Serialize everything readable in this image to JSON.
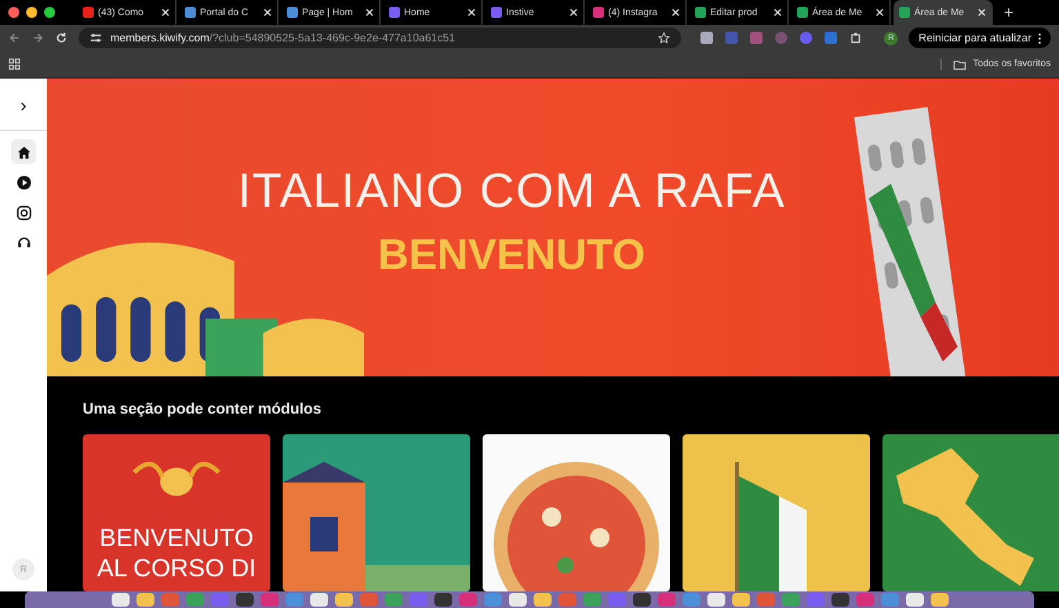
{
  "browser": {
    "tabs": [
      {
        "title": "(43) Como",
        "color": "#e62117",
        "selected": false
      },
      {
        "title": "Portal do C",
        "color": "#4a8fd8",
        "selected": false
      },
      {
        "title": "Page | Hom",
        "color": "#4a8fd8",
        "selected": false
      },
      {
        "title": "Home",
        "color": "#7a5cf0",
        "selected": false
      },
      {
        "title": "Instive",
        "color": "#7a5cf0",
        "selected": false
      },
      {
        "title": "(4) Instagra",
        "color": "#d6307a",
        "selected": false
      },
      {
        "title": "Editar prod",
        "color": "#22a35a",
        "selected": false
      },
      {
        "title": "Área de Me",
        "color": "#22a35a",
        "selected": false
      },
      {
        "title": "Área de Me",
        "color": "#22a35a",
        "selected": true
      }
    ],
    "new_tab": "+",
    "url_host": "members.kiwify.com",
    "url_path": "/?club=54890525-5a13-469c-9e2e-477a10a61c51",
    "profile": "R",
    "update_button": "Reiniciar para atualizar",
    "bookmarks_folder": "Todos os favoritos"
  },
  "sidebar": {
    "toggle": "›",
    "items": [
      {
        "kind": "home",
        "selected": true
      },
      {
        "kind": "play",
        "selected": false
      },
      {
        "kind": "instagram",
        "selected": false
      },
      {
        "kind": "support",
        "selected": false
      }
    ],
    "avatar": "R"
  },
  "banner": {
    "title": "ITALIANO COM A RAFA",
    "subtitle": "BENVENUTO"
  },
  "section": {
    "title": "Uma seção pode conter módulos",
    "modules": [
      {
        "kind": "text",
        "lines": [
          "BENVENUTO",
          "AL CORSO DI"
        ]
      },
      {
        "kind": "house"
      },
      {
        "kind": "pizza"
      },
      {
        "kind": "flag"
      },
      {
        "kind": "map"
      }
    ]
  }
}
